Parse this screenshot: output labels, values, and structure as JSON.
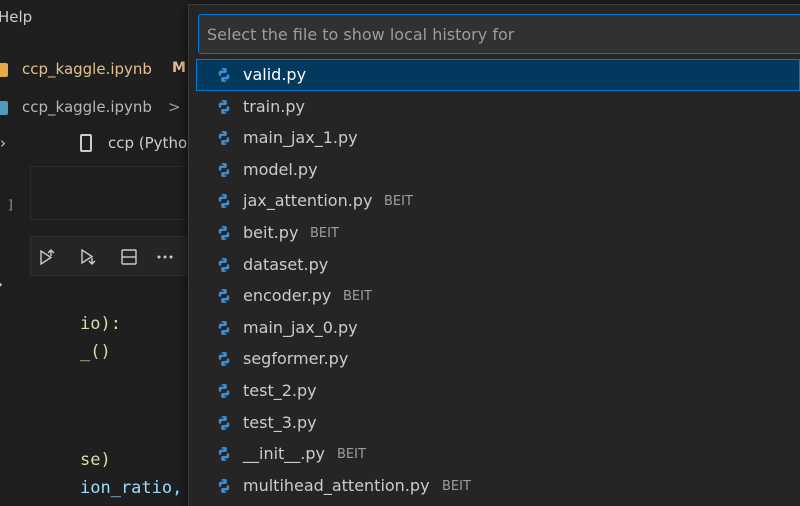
{
  "menu": {
    "help": "Help"
  },
  "tab": {
    "label": "ccp_kaggle.ipynb",
    "modified": "M"
  },
  "breadcrumb": {
    "file": "ccp_kaggle.ipynb",
    "separator": ">"
  },
  "kernel": {
    "label": "ccp (Pytho"
  },
  "cell": {
    "bracket": "]"
  },
  "code_lines": [
    "io):",
    "_()",
    "se)",
    "ion_ratio,"
  ],
  "quickpick": {
    "placeholder": "Select the file to show local history for",
    "items": [
      {
        "label": "valid.py",
        "desc": ""
      },
      {
        "label": "train.py",
        "desc": ""
      },
      {
        "label": "main_jax_1.py",
        "desc": ""
      },
      {
        "label": "model.py",
        "desc": ""
      },
      {
        "label": "jax_attention.py",
        "desc": "BEIT"
      },
      {
        "label": "beit.py",
        "desc": "BEIT"
      },
      {
        "label": "dataset.py",
        "desc": ""
      },
      {
        "label": "encoder.py",
        "desc": "BEIT"
      },
      {
        "label": "main_jax_0.py",
        "desc": ""
      },
      {
        "label": "segformer.py",
        "desc": ""
      },
      {
        "label": "test_2.py",
        "desc": ""
      },
      {
        "label": "test_3.py",
        "desc": ""
      },
      {
        "label": "__init__.py",
        "desc": "BEIT"
      },
      {
        "label": "multihead_attention.py",
        "desc": "BEIT"
      }
    ]
  },
  "colors": {
    "accent": "#0078d4",
    "selected_bg": "#04395e",
    "python_blue": "#3d8fd1"
  }
}
